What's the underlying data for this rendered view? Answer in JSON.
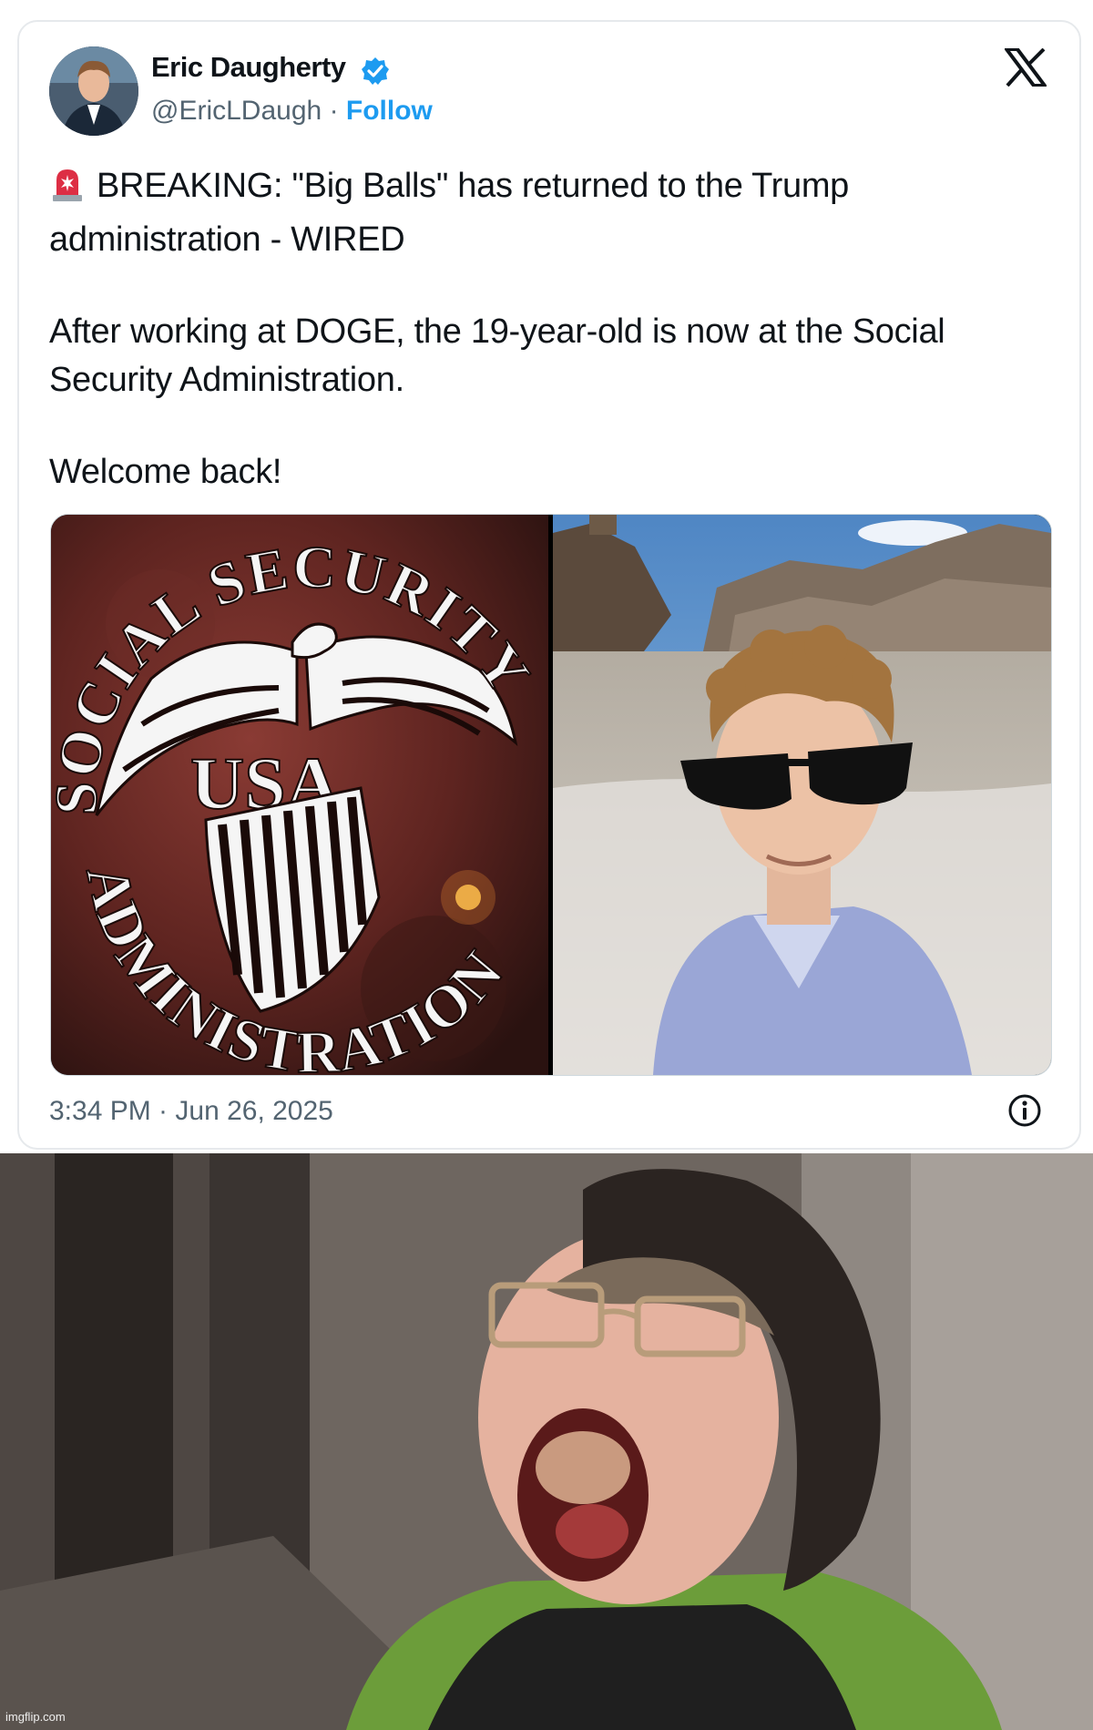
{
  "tweet": {
    "author_name": "Eric Daugherty",
    "handle": "@EricLDaugh",
    "separator": "·",
    "follow_label": "Follow",
    "line1": "BREAKING: \"Big Balls\" has returned to the Trump administration - WIRED",
    "line2": "After working at DOGE, the 19-year-old is now at the Social Security Administration.",
    "line3": "Welcome back!",
    "timestamp": "3:34 PM · Jun 26, 2025",
    "icons": {
      "verified": "verified-badge-icon",
      "platform": "x-logo-icon",
      "siren": "rotating-light-emoji-icon",
      "info": "info-icon"
    },
    "colors": {
      "link": "#1d9bf0",
      "secondary_text": "#536471",
      "border": "#e6e9ec"
    }
  },
  "media": {
    "seal_top_arc": "SOCIAL SECURITY",
    "seal_center": "USA",
    "seal_bottom_arc": "ADMINISTRATION"
  },
  "watermark": "imgflip.com"
}
